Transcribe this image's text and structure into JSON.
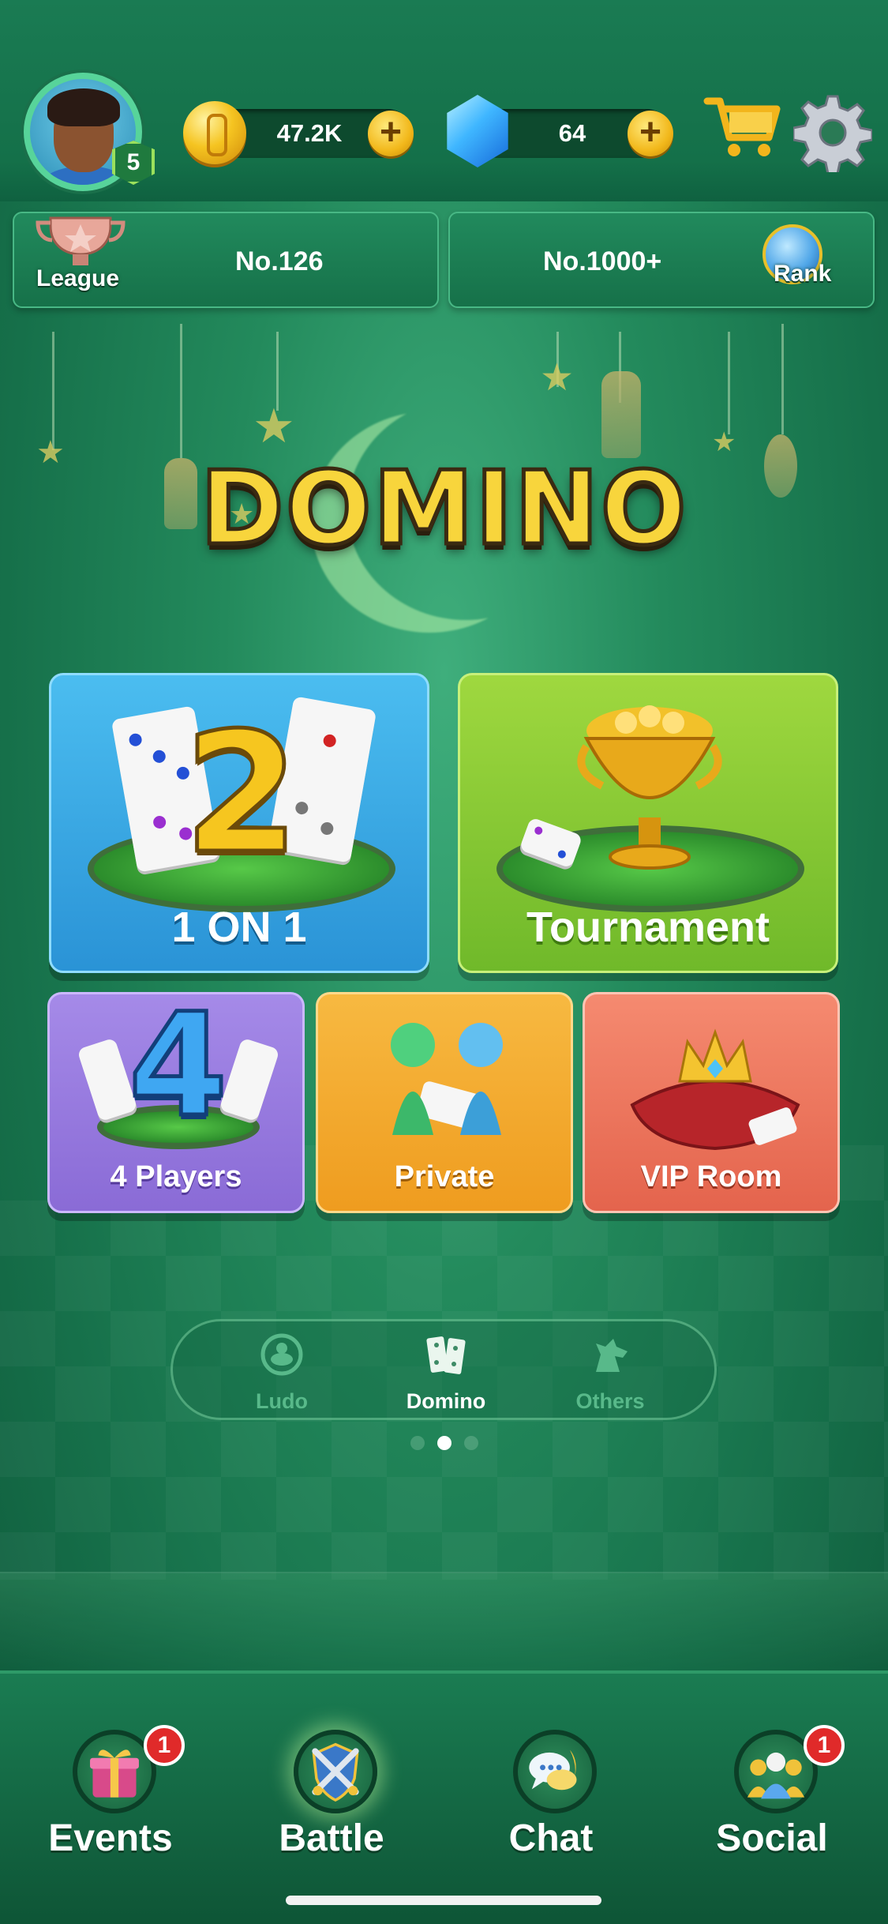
{
  "profile": {
    "level": "5"
  },
  "wallet": {
    "coins": "47.2K",
    "gems": "64",
    "plus": "+"
  },
  "panels": {
    "league": {
      "caption": "League",
      "value": "No.126"
    },
    "rank": {
      "caption": "Rank",
      "value": "No.1000+"
    }
  },
  "logo": {
    "text": "DOMINO"
  },
  "modes": {
    "one_on_one": {
      "label": "1 ON 1",
      "number": "2"
    },
    "tournament": {
      "label": "Tournament"
    },
    "four_players": {
      "label": "4 Players",
      "number": "4"
    },
    "private": {
      "label": "Private"
    },
    "vip_room": {
      "label": "VIP Room"
    }
  },
  "game_switcher": {
    "items": [
      {
        "label": "Ludo",
        "active": false
      },
      {
        "label": "Domino",
        "active": true
      },
      {
        "label": "Others",
        "active": false
      }
    ],
    "page_count": 3,
    "page_index": 1
  },
  "bottom_nav": {
    "items": [
      {
        "label": "Events",
        "badge": "1",
        "icon": "gift-icon"
      },
      {
        "label": "Battle",
        "badge": "",
        "icon": "crossed-swords-icon"
      },
      {
        "label": "Chat",
        "badge": "",
        "icon": "chat-bubble-icon"
      },
      {
        "label": "Social",
        "badge": "1",
        "icon": "people-icon"
      }
    ]
  },
  "colors": {
    "active_tab_text": "#ffffff",
    "inactive_tab_text": "#58b98a",
    "badge": "#e02a2a"
  }
}
